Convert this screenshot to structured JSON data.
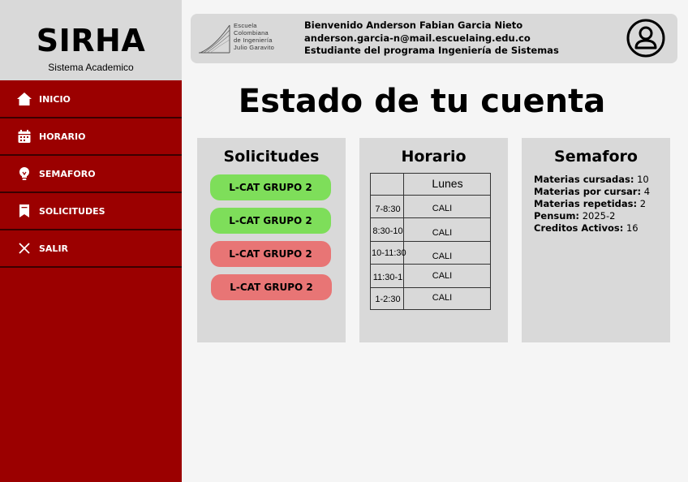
{
  "brand": {
    "title": "SIRHA",
    "subtitle": "Sistema Academico"
  },
  "nav": {
    "items": [
      {
        "label": "INICIO",
        "icon": "home-icon"
      },
      {
        "label": "HORARIO",
        "icon": "calendar-icon"
      },
      {
        "label": "SEMAFORO",
        "icon": "lightbulb-icon"
      },
      {
        "label": "SOLICITUDES",
        "icon": "bookmark-icon"
      },
      {
        "label": "SALIR",
        "icon": "close-icon"
      }
    ]
  },
  "header": {
    "logo_lines": [
      "Escuela",
      "Colombiana",
      "de Ingeniería",
      "Julio Garavito"
    ],
    "welcome": "Bienvenido Anderson Fabian Garcia Nieto",
    "email": "anderson.garcia-n@mail.escuelaing.edu.co",
    "program": "Estudiante del programa Ingeniería de Sistemas"
  },
  "page": {
    "title": "Estado de tu cuenta"
  },
  "solicitudes": {
    "title": "Solicitudes",
    "items": [
      {
        "label": "L-CAT GRUPO 2",
        "status": "approved",
        "color": "#7ede5a"
      },
      {
        "label": "L-CAT GRUPO 2",
        "status": "approved",
        "color": "#7ede5a"
      },
      {
        "label": "L-CAT GRUPO 2",
        "status": "rejected",
        "color": "#e87575"
      },
      {
        "label": "L-CAT GRUPO 2",
        "status": "rejected",
        "color": "#e87575"
      }
    ]
  },
  "horario": {
    "title": "Horario",
    "day": "Lunes",
    "rows": [
      {
        "time": "7-8:30",
        "class": "CALI"
      },
      {
        "time": "8:30-10",
        "class": "CALI"
      },
      {
        "time": "10-11:30",
        "class": "CALI"
      },
      {
        "time": "11:30-1",
        "class": "CALI"
      },
      {
        "time": "1-2:30",
        "class": "CALI"
      }
    ]
  },
  "semaforo": {
    "title": "Semaforo",
    "stats": [
      {
        "label": "Materias cursadas:",
        "value": "10"
      },
      {
        "label": "Materias por cursar:",
        "value": "4"
      },
      {
        "label": "Materias repetidas:",
        "value": "2"
      },
      {
        "label": "Pensum:",
        "value": "2025-2"
      },
      {
        "label": "Creditos Activos:",
        "value": "16"
      }
    ]
  },
  "colors": {
    "sidebar": "#9b0000",
    "panel": "#d9d9d9",
    "approved": "#7ede5a",
    "rejected": "#e87575"
  }
}
